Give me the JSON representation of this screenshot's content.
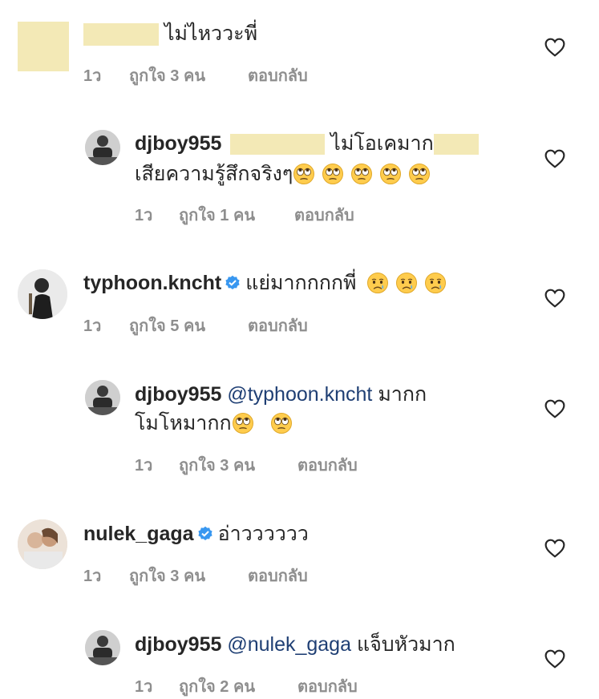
{
  "comments": [
    {
      "username": "",
      "text": "ไม่ไหววะพี่",
      "time": "1ว",
      "likes": "ถูกใจ 3 คน",
      "reply": "ตอบกลับ"
    },
    {
      "username": "djboy955",
      "text_a": "ไม่โอเคมาก",
      "text_b": "เสียความรู้สึกจริงๆ",
      "emoji_count": 5,
      "emoji": "eye-roll",
      "time": "1ว",
      "likes": "ถูกใจ 1 คน",
      "reply": "ตอบกลับ"
    },
    {
      "username": "typhoon.kncht",
      "verified": true,
      "text": "แย่มากกกกพี่",
      "emoji_count": 3,
      "emoji": "crying",
      "time": "1ว",
      "likes": "ถูกใจ 5 คน",
      "reply": "ตอบกลับ"
    },
    {
      "username": "djboy955",
      "mention": "@typhoon.kncht",
      "text_a": "มากก",
      "text_b": "โมโหมากก",
      "emoji_count": 2,
      "emoji": "eye-roll",
      "time": "1ว",
      "likes": "ถูกใจ 3 คน",
      "reply": "ตอบกลับ"
    },
    {
      "username": "nulek_gaga",
      "verified": true,
      "text": "อ่าวววววว",
      "time": "1ว",
      "likes": "ถูกใจ 3 คน",
      "reply": "ตอบกลับ"
    },
    {
      "username": "djboy955",
      "mention": "@nulek_gaga",
      "text": "แจ็บหัวมาก",
      "time": "1ว",
      "likes": "ถูกใจ 2 คน",
      "reply": "ตอบกลับ"
    }
  ],
  "icons": {
    "like": "heart-outline-icon",
    "verified": "verified-badge-icon"
  },
  "colors": {
    "text": "#262626",
    "meta": "#8e8e8e",
    "mention": "#1f3f74",
    "verified": "#3897f0",
    "redaction": "#f3e9b6"
  }
}
